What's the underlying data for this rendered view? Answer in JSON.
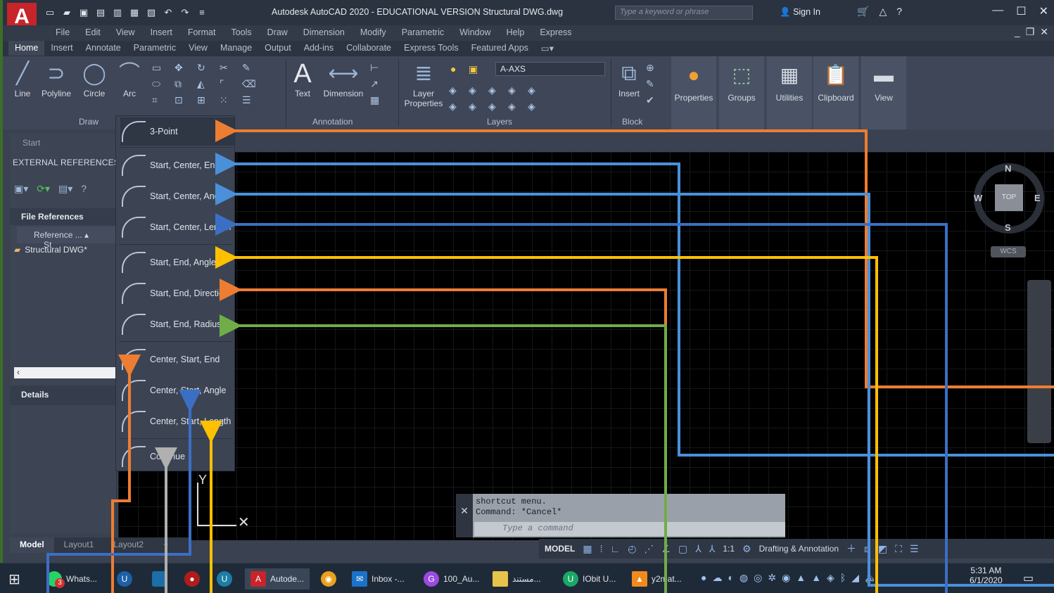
{
  "app": {
    "window_title": "Autodesk AutoCAD 2020 - EDUCATIONAL VERSION    Structural DWG.dwg",
    "search_placeholder": "Type a keyword or phrase",
    "sign_in": "Sign In",
    "logo_letter": "A"
  },
  "menu": [
    "File",
    "Edit",
    "View",
    "Insert",
    "Format",
    "Tools",
    "Draw",
    "Dimension",
    "Modify",
    "Parametric",
    "Window",
    "Help",
    "Express"
  ],
  "ribbon_tabs": [
    "Home",
    "Insert",
    "Annotate",
    "Parametric",
    "View",
    "Manage",
    "Output",
    "Add-ins",
    "Collaborate",
    "Express Tools",
    "Featured Apps"
  ],
  "ribbon": {
    "line": "Line",
    "polyline": "Polyline",
    "circle": "Circle",
    "arc": "Arc",
    "draw_panel": "Draw",
    "text": "Text",
    "dimension": "Dimension",
    "annotation_panel": "Annotation",
    "layer_properties": "Layer Properties",
    "layer_current": "A-AXS",
    "layers_panel": "Layers",
    "insert": "Insert",
    "block_panel": "Block",
    "properties": "Properties",
    "groups": "Groups",
    "utilities": "Utilities",
    "clipboard": "Clipboard",
    "view": "View"
  },
  "arc_menu": [
    "3-Point",
    "Start, Center, End",
    "Start, Center, Angle",
    "Start, Center, Length",
    "Start, End, Angle",
    "Start, End, Direction",
    "Start, End, Radius",
    "Center, Start, End",
    "Center, Start, Angle",
    "Center, Start, Length",
    "Continue"
  ],
  "palette": {
    "start_tab": "Start",
    "title": "EXTERNAL REFERENCES",
    "file_references": "File References",
    "column_reference": "Reference ...",
    "column_status": "St",
    "xref_name": "Structural DWG*",
    "details": "Details"
  },
  "viewcube": {
    "n": "N",
    "s": "S",
    "e": "E",
    "w": "W",
    "face": "TOP",
    "wcs": "WCS"
  },
  "command": {
    "history_1": "shortcut menu.",
    "history_2": "Command: *Cancel*",
    "input_placeholder": "Type a command"
  },
  "layout_tabs": [
    "Model",
    "Layout1",
    "Layout2",
    "+"
  ],
  "status": {
    "model": "MODEL",
    "scale": "1:1",
    "workspace": "Drafting & Annotation"
  },
  "taskbar": {
    "whatsapp": "Whats...",
    "whatsapp_badge": "3",
    "autocad": "Autode...",
    "inbox": "Inbox -...",
    "aura": "100_Au...",
    "folder": "مستند...",
    "iobit": "IObit U...",
    "vlc": "y2mat...",
    "clock_time": "5:31 AM",
    "clock_date": "6/1/2020"
  },
  "arrow_colors": {
    "orange": "#ed7d31",
    "blue": "#4a90d9",
    "yellow": "#ffc000",
    "green": "#70ad47",
    "gray": "#b0b0b0",
    "dark_blue": "#3b6fc4"
  }
}
